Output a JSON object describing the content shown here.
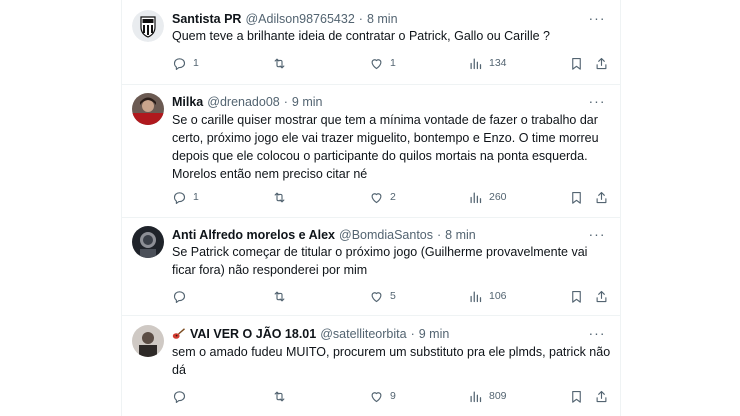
{
  "colors": {
    "text": "#0f1419",
    "muted": "#536471",
    "border": "#eff3f4"
  },
  "tweets": [
    {
      "name": "Santista PR",
      "handle": "@Adilson98765432",
      "dot": "·",
      "time": "8 min",
      "text": "Quem teve a brilhante ideia de contratar o Patrick, Gallo ou Carille  ?",
      "replies": "1",
      "retweets": "",
      "likes": "1",
      "views": "134",
      "avatar_icon": "santos-crest-icon"
    },
    {
      "name": "Milka",
      "handle": "@drenado08",
      "dot": "·",
      "time": "9 min",
      "text": "Se o carille quiser mostrar que tem a mínima vontade de fazer o trabalho dar certo, próximo jogo ele vai trazer miguelito, bontempo e Enzo. O time morreu depois que ele colocou o participante do quilos mortais na ponta esquerda. Morelos então nem preciso citar né",
      "replies": "1",
      "retweets": "",
      "likes": "2",
      "views": "260",
      "avatar_icon": "user-photo-icon"
    },
    {
      "name": "Anti Alfredo morelos e Alex",
      "handle": "@BomdiaSantos",
      "dot": "·",
      "time": "8 min",
      "text": "Se Patrick começar de titular o próximo jogo (Guilherme provavelmente vai ficar fora) não responderei por mim",
      "replies": "",
      "retweets": "",
      "likes": "5",
      "views": "106",
      "avatar_icon": "user-photo-icon"
    },
    {
      "name": "VAI VER O JÃO 18.01",
      "handle": "@satelliteorbita",
      "dot": "·",
      "time": "9 min",
      "text": "sem o amado fudeu MUITO, procurem um substituto pra ele plmds, patrick não dá",
      "replies": "",
      "retweets": "",
      "likes": "9",
      "views": "809",
      "avatar_icon": "user-photo-icon",
      "name_emoji": "guitar-emoji-icon"
    }
  ],
  "icons": {
    "more": "more-dots-icon",
    "reply": "reply-icon",
    "retweet": "retweet-icon",
    "like": "heart-icon",
    "views": "views-chart-icon",
    "bookmark": "bookmark-icon",
    "share": "share-icon"
  }
}
